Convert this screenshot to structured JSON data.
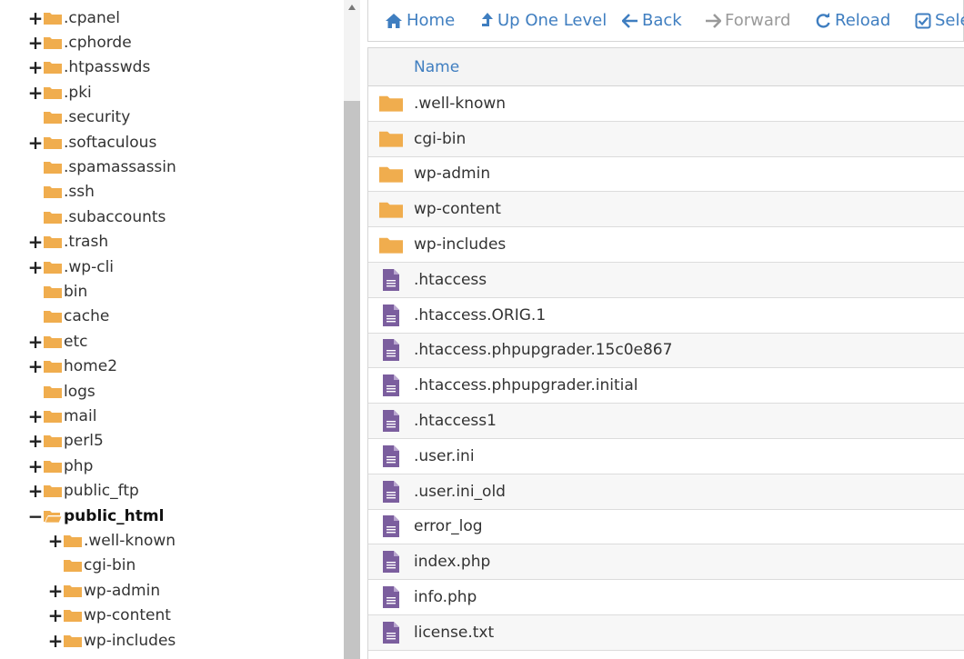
{
  "tree": {
    "items": [
      {
        "label": ".cpanel",
        "toggle": "+",
        "level": 0
      },
      {
        "label": ".cphorde",
        "toggle": "+",
        "level": 0
      },
      {
        "label": ".htpasswds",
        "toggle": "+",
        "level": 0
      },
      {
        "label": ".pki",
        "toggle": "+",
        "level": 0
      },
      {
        "label": ".security",
        "toggle": "",
        "level": 0
      },
      {
        "label": ".softaculous",
        "toggle": "+",
        "level": 0
      },
      {
        "label": ".spamassassin",
        "toggle": "",
        "level": 0
      },
      {
        "label": ".ssh",
        "toggle": "",
        "level": 0
      },
      {
        "label": ".subaccounts",
        "toggle": "",
        "level": 0
      },
      {
        "label": ".trash",
        "toggle": "+",
        "level": 0
      },
      {
        "label": ".wp-cli",
        "toggle": "+",
        "level": 0
      },
      {
        "label": "bin",
        "toggle": "",
        "level": 0
      },
      {
        "label": "cache",
        "toggle": "",
        "level": 0
      },
      {
        "label": "etc",
        "toggle": "+",
        "level": 0
      },
      {
        "label": "home2",
        "toggle": "+",
        "level": 0
      },
      {
        "label": "logs",
        "toggle": "",
        "level": 0
      },
      {
        "label": "mail",
        "toggle": "+",
        "level": 0
      },
      {
        "label": "perl5",
        "toggle": "+",
        "level": 0
      },
      {
        "label": "php",
        "toggle": "+",
        "level": 0
      },
      {
        "label": "public_ftp",
        "toggle": "+",
        "level": 0
      },
      {
        "label": "public_html",
        "toggle": "−",
        "level": 0,
        "open": true,
        "bold": true
      },
      {
        "label": ".well-known",
        "toggle": "+",
        "level": 1
      },
      {
        "label": "cgi-bin",
        "toggle": "",
        "level": 1
      },
      {
        "label": "wp-admin",
        "toggle": "+",
        "level": 1
      },
      {
        "label": "wp-content",
        "toggle": "+",
        "level": 1
      },
      {
        "label": "wp-includes",
        "toggle": "+",
        "level": 1
      }
    ]
  },
  "toolbar": {
    "buttons": [
      {
        "label": "Home",
        "icon": "home-icon",
        "enabled": true
      },
      {
        "label": "Up One Level",
        "icon": "level-up-icon",
        "enabled": true
      },
      {
        "label": "Back",
        "icon": "arrow-left-icon",
        "enabled": true
      },
      {
        "label": "Forward",
        "icon": "arrow-right-icon",
        "enabled": false
      },
      {
        "label": "Reload",
        "icon": "reload-icon",
        "enabled": true
      },
      {
        "label": "Sele",
        "icon": "check-square-icon",
        "enabled": true
      }
    ]
  },
  "table": {
    "header": {
      "name": "Name"
    },
    "rows": [
      {
        "name": ".well-known",
        "type": "folder"
      },
      {
        "name": "cgi-bin",
        "type": "folder"
      },
      {
        "name": "wp-admin",
        "type": "folder"
      },
      {
        "name": "wp-content",
        "type": "folder"
      },
      {
        "name": "wp-includes",
        "type": "folder"
      },
      {
        "name": ".htaccess",
        "type": "file"
      },
      {
        "name": ".htaccess.ORIG.1",
        "type": "file"
      },
      {
        "name": ".htaccess.phpupgrader.15c0e867",
        "type": "file"
      },
      {
        "name": ".htaccess.phpupgrader.initial",
        "type": "file"
      },
      {
        "name": ".htaccess1",
        "type": "file"
      },
      {
        "name": ".user.ini",
        "type": "file"
      },
      {
        "name": ".user.ini_old",
        "type": "file"
      },
      {
        "name": "error_log",
        "type": "file"
      },
      {
        "name": "index.php",
        "type": "file"
      },
      {
        "name": "info.php",
        "type": "file"
      },
      {
        "name": "license.txt",
        "type": "file"
      }
    ]
  },
  "colors": {
    "folder": "#f0ad4e",
    "file": "#7b5e9e",
    "link": "#3f7ec0",
    "disabled": "#9a9a9a"
  }
}
